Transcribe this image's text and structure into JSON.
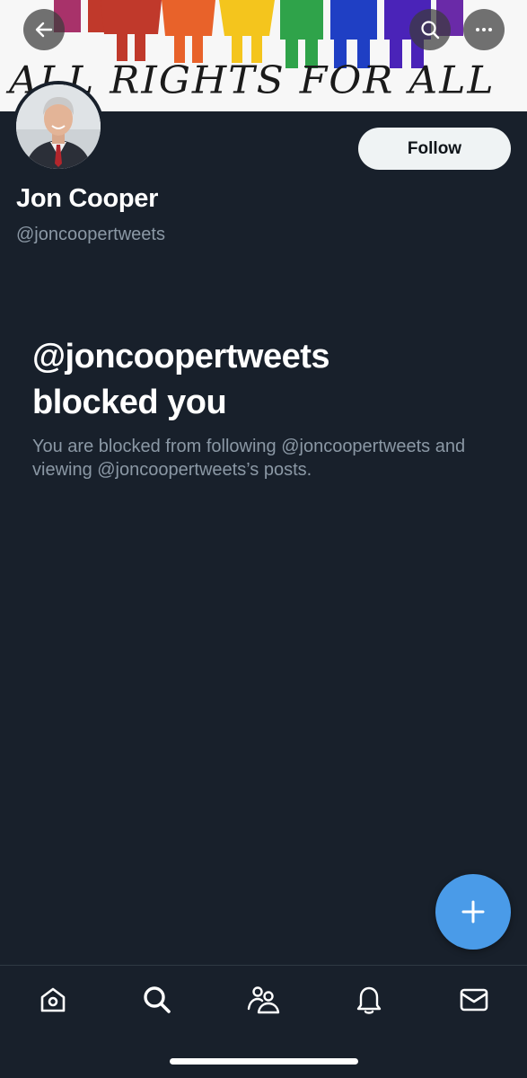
{
  "banner": {
    "text": "ALL RIGHTS FOR ALL",
    "colors": [
      "#c0392b",
      "#e8622a",
      "#f4c51d",
      "#2fa34a",
      "#1f3fc4",
      "#6a2aa8"
    ]
  },
  "header": {
    "back_icon": "arrow-left-icon",
    "search_icon": "search-icon",
    "more_icon": "more-horizontal-icon"
  },
  "profile": {
    "display_name": "Jon Cooper",
    "handle": "@joncoopertweets",
    "follow_label": "Follow"
  },
  "blocked": {
    "title_line1": "@joncoopertweets",
    "title_line2": "blocked you",
    "description": "You are blocked from following @joncoopertweets and viewing @joncoopertweets’s posts."
  },
  "fab": {
    "icon": "plus-icon",
    "color": "#4a9be8"
  },
  "bottom_nav": {
    "items": [
      "home-icon",
      "search-icon",
      "communities-icon",
      "notifications-icon",
      "messages-icon"
    ]
  },
  "theme": {
    "background": "#18202b",
    "secondary_text": "#8b98a5"
  }
}
